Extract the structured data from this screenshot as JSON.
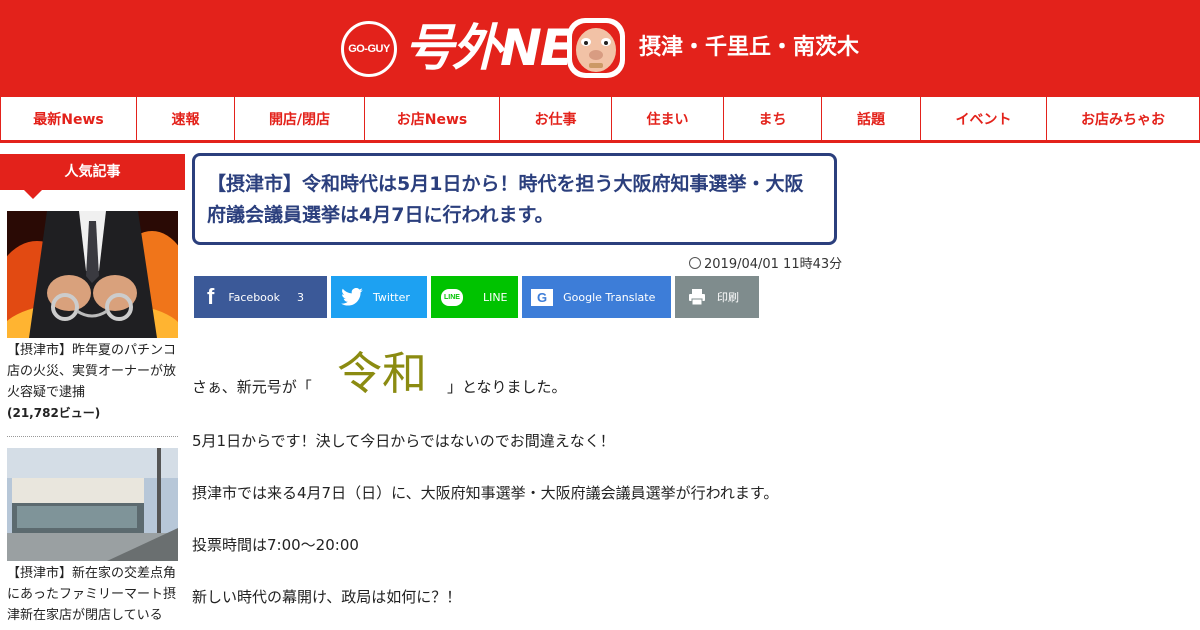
{
  "header": {
    "logo_circle": "GO-GUY",
    "logo_text": "号外NET",
    "area": "摂津・千里丘・南茨木",
    "colors": {
      "brand": "#e3221b",
      "title": "#2b3f7d"
    }
  },
  "nav": [
    "最新News",
    "速報",
    "開店/閉店",
    "お店News",
    "お仕事",
    "住まい",
    "まち",
    "話題",
    "イベント",
    "お店みちゃお"
  ],
  "sidebar": {
    "heading": "人気記事",
    "items": [
      {
        "text": "【摂津市】昨年夏のパチンコ店の火災、実質オーナーが放火容疑で逮捕",
        "views": "(21,782ビュー)"
      },
      {
        "text": "【摂津市】新在家の交差点角にあったファミリーマート摂津新在家店が閉店している"
      }
    ]
  },
  "article": {
    "title": "【摂津市】令和時代は5月1日から！時代を担う大阪府知事選挙・大阪府議会議員選挙は4月7日に行われます。",
    "date": "2019/04/01 11時43分",
    "share": [
      {
        "name": "Facebook",
        "count": "3",
        "icon": "f",
        "color": "#3b5998"
      },
      {
        "name": "Twitter",
        "icon": "twitter-bird",
        "color": "#1da1f2"
      },
      {
        "name": "LINE",
        "icon": "LINE",
        "color": "#00c300"
      },
      {
        "name": "Google Translate",
        "icon": "G",
        "color": "#3d7dd8"
      },
      {
        "name": "印刷",
        "icon": "printer",
        "color": "#7f8c8d"
      }
    ],
    "intro_before": "さぁ、新元号が「",
    "era_name": "令和",
    "intro_after": "」となりました。",
    "paragraphs": [
      "5月1日からです！決して今日からではないのでお間違えなく！",
      "摂津市では来る4月7日（日）に、大阪府知事選挙・大阪府議会議員選挙が行われます。",
      "投票時間は7:00〜20:00",
      "新しい時代の幕開け、政局は如何に？！"
    ]
  }
}
